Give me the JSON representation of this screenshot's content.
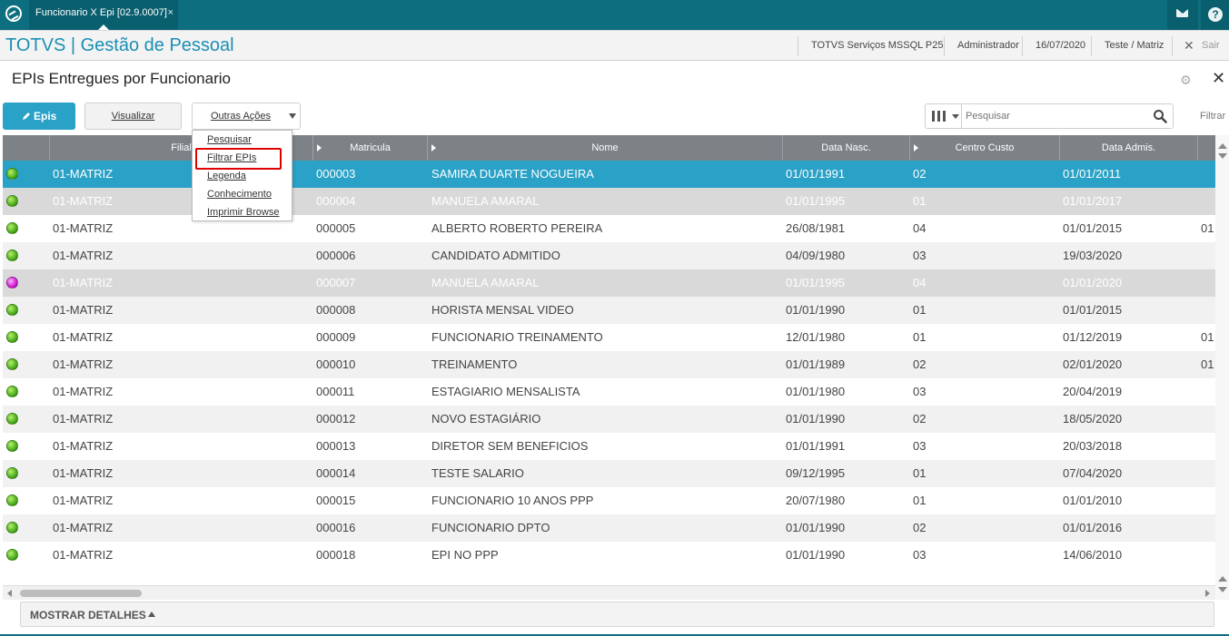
{
  "topbar": {
    "tab_title": "Funcionario X Epi [02.9.0007]",
    "tab_close": "×",
    "icons": [
      "logo-icon",
      "mail-icon",
      "help-icon"
    ],
    "help_glyph": "?"
  },
  "header": {
    "app_title": "TOTVS | Gestão de Pessoal",
    "environment": "TOTVS Serviços MSSQL P25",
    "user": "Administrador",
    "date": "16/07/2020",
    "company": "Teste / Matriz",
    "logout_label": "Sair",
    "logout_glyph": "✕"
  },
  "page": {
    "title": "EPIs Entregues por Funcionario",
    "settings_glyph": "⚙",
    "close_glyph": "✕"
  },
  "toolbar": {
    "epis_label": "Epis",
    "visualizar_label": "Visualizar",
    "outras_label": "Outras Ações",
    "search_placeholder": "Pesquisar",
    "filter_label": "Filtrar"
  },
  "menu": {
    "items": [
      "Pesquisar",
      "Filtrar EPIs",
      "Legenda",
      "Conhecimento",
      "Imprimir Browse"
    ],
    "highlighted": "Filtrar EPIs"
  },
  "grid": {
    "columns": [
      "Filial",
      "Matricula",
      "Nome",
      "Data Nasc.",
      "Centro Custo",
      "Data Admis."
    ],
    "rows": [
      {
        "status": "green",
        "filial": "01-MATRIZ",
        "matricula": "000003",
        "nome": "SAMIRA DUARTE NOGUEIRA",
        "nasc": "01/01/1991",
        "cc": "02",
        "admis": "01/01/2011",
        "extra": ""
      },
      {
        "status": "green",
        "filial": "01-MATRIZ",
        "matricula": "000004",
        "nome": "MANUELA AMARAL",
        "nasc": "01/01/1995",
        "cc": "01",
        "admis": "01/01/2017",
        "extra": ""
      },
      {
        "status": "green",
        "filial": "01-MATRIZ",
        "matricula": "000005",
        "nome": "ALBERTO ROBERTO PEREIRA",
        "nasc": "26/08/1981",
        "cc": "04",
        "admis": "01/01/2015",
        "extra": "01"
      },
      {
        "status": "green",
        "filial": "01-MATRIZ",
        "matricula": "000006",
        "nome": "CANDIDATO ADMITIDO",
        "nasc": "04/09/1980",
        "cc": "03",
        "admis": "19/03/2020",
        "extra": ""
      },
      {
        "status": "magenta",
        "filial": "01-MATRIZ",
        "matricula": "000007",
        "nome": "MANUELA AMARAL",
        "nasc": "01/01/1995",
        "cc": "04",
        "admis": "01/01/2020",
        "extra": ""
      },
      {
        "status": "green",
        "filial": "01-MATRIZ",
        "matricula": "000008",
        "nome": "HORISTA MENSAL VIDEO",
        "nasc": "01/01/1990",
        "cc": "01",
        "admis": "01/01/2015",
        "extra": ""
      },
      {
        "status": "green",
        "filial": "01-MATRIZ",
        "matricula": "000009",
        "nome": "FUNCIONARIO TREINAMENTO",
        "nasc": "12/01/1980",
        "cc": "01",
        "admis": "01/12/2019",
        "extra": "01"
      },
      {
        "status": "green",
        "filial": "01-MATRIZ",
        "matricula": "000010",
        "nome": "TREINAMENTO",
        "nasc": "01/01/1989",
        "cc": "02",
        "admis": "02/01/2020",
        "extra": "01"
      },
      {
        "status": "green",
        "filial": "01-MATRIZ",
        "matricula": "000011",
        "nome": "ESTAGIARIO MENSALISTA",
        "nasc": "01/01/1980",
        "cc": "03",
        "admis": "20/04/2019",
        "extra": ""
      },
      {
        "status": "green",
        "filial": "01-MATRIZ",
        "matricula": "000012",
        "nome": "NOVO ESTAGIÁRIO",
        "nasc": "01/01/1990",
        "cc": "02",
        "admis": "18/05/2020",
        "extra": ""
      },
      {
        "status": "green",
        "filial": "01-MATRIZ",
        "matricula": "000013",
        "nome": "DIRETOR SEM BENEFICIOS",
        "nasc": "01/01/1991",
        "cc": "03",
        "admis": "20/03/2018",
        "extra": ""
      },
      {
        "status": "green",
        "filial": "01-MATRIZ",
        "matricula": "000014",
        "nome": "TESTE SALARIO",
        "nasc": "09/12/1995",
        "cc": "01",
        "admis": "07/04/2020",
        "extra": ""
      },
      {
        "status": "green",
        "filial": "01-MATRIZ",
        "matricula": "000015",
        "nome": "FUNCIONARIO 10 ANOS PPP",
        "nasc": "20/07/1980",
        "cc": "01",
        "admis": "01/01/2010",
        "extra": ""
      },
      {
        "status": "green",
        "filial": "01-MATRIZ",
        "matricula": "000016",
        "nome": "FUNCIONARIO DPTO",
        "nasc": "01/01/1990",
        "cc": "02",
        "admis": "01/01/2016",
        "extra": ""
      },
      {
        "status": "green",
        "filial": "01-MATRIZ",
        "matricula": "000018",
        "nome": "EPI NO PPP",
        "nasc": "01/01/1990",
        "cc": "03",
        "admis": "14/06/2010",
        "extra": ""
      }
    ],
    "selected_index": 0,
    "dim_indices": [
      1,
      4
    ]
  },
  "details": {
    "label": "MOSTRAR DETALHES"
  },
  "colors": {
    "topbar": "#0c6e7f",
    "accent": "#2aa1c6",
    "title_blue": "#1b8fb4",
    "header_gray": "#7d8287",
    "highlight_red": "#e00000"
  }
}
